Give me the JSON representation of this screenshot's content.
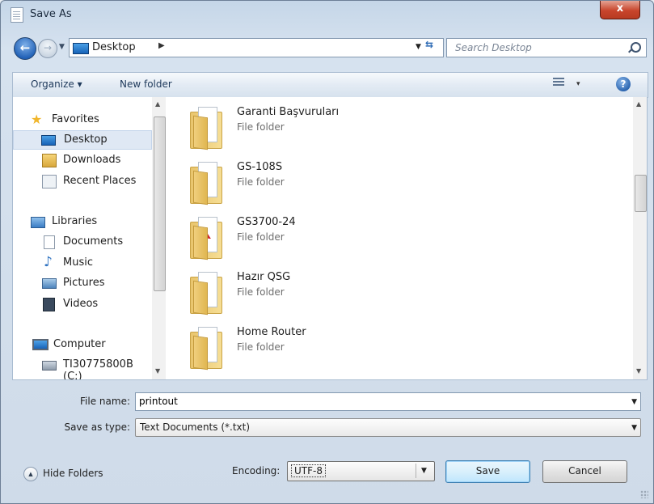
{
  "window": {
    "title": "Save As",
    "close_label": "x"
  },
  "address_bar": {
    "location": "Desktop"
  },
  "search": {
    "placeholder": "Search Desktop"
  },
  "toolbar": {
    "organize_label": "Organize ▾",
    "new_folder_label": "New folder",
    "views_drop": "▾",
    "help_label": "?"
  },
  "nav_pane": {
    "favorites": {
      "label": "Favorites",
      "items": [
        "Desktop",
        "Downloads",
        "Recent Places"
      ],
      "selected": "Desktop"
    },
    "libraries": {
      "label": "Libraries",
      "items": [
        "Documents",
        "Music",
        "Pictures",
        "Videos"
      ]
    },
    "computer": {
      "label": "Computer",
      "items": [
        "TI30775800B (C:)"
      ]
    }
  },
  "files": [
    {
      "name": "Garanti Başvuruları",
      "type": "File folder",
      "icon": "folder-icon"
    },
    {
      "name": "GS-108S",
      "type": "File folder",
      "icon": "folder-icon"
    },
    {
      "name": "GS3700-24",
      "type": "File folder",
      "icon": "folder-pdf-icon"
    },
    {
      "name": "Hazır QSG",
      "type": "File folder",
      "icon": "folder-icon"
    },
    {
      "name": "Home Router",
      "type": "File folder",
      "icon": "folder-icon"
    }
  ],
  "form": {
    "file_name_label": "File name:",
    "file_name_value": "printout",
    "save_as_type_label": "Save as type:",
    "save_as_type_value": "Text Documents (*.txt)",
    "encoding_label": "Encoding:",
    "encoding_value": "UTF-8"
  },
  "footer": {
    "hide_folders_label": "Hide Folders",
    "save_label": "Save",
    "cancel_label": "Cancel"
  }
}
